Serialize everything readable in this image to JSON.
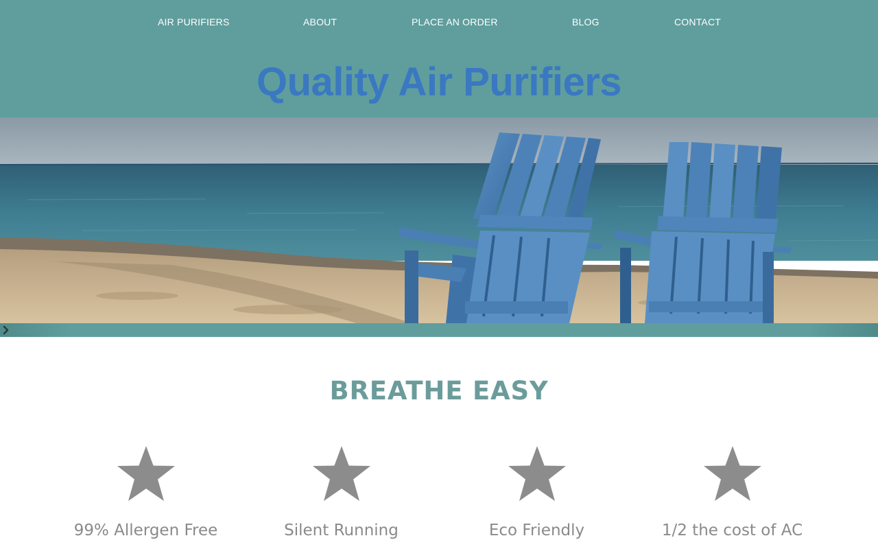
{
  "nav": {
    "items": [
      {
        "label": "AIR PURIFIERS"
      },
      {
        "label": "ABOUT"
      },
      {
        "label": "PLACE AN ORDER"
      },
      {
        "label": "BLOG"
      },
      {
        "label": "CONTACT"
      }
    ]
  },
  "header": {
    "title": "Quality Air Purifiers",
    "background_color": "#5f9e9d",
    "title_color": "#3a78c2"
  },
  "slider": {
    "slide_count": 3,
    "active_slide": 2,
    "prev_icon": "chevron-left-icon",
    "next_icon": "chevron-right-icon"
  },
  "section": {
    "heading": "BREATHE EASY",
    "heading_color": "#6b9c9b"
  },
  "features": [
    {
      "label": "99% Allergen Free",
      "icon": "star-icon"
    },
    {
      "label": "Silent Running",
      "icon": "star-icon"
    },
    {
      "label": "Eco Friendly",
      "icon": "star-icon"
    },
    {
      "label": "1/2 the cost of AC",
      "icon": "star-icon"
    }
  ],
  "colors": {
    "accent": "#5f9e9d",
    "icon_gray": "#8c8c8c",
    "text_gray": "#8a8a8a"
  }
}
